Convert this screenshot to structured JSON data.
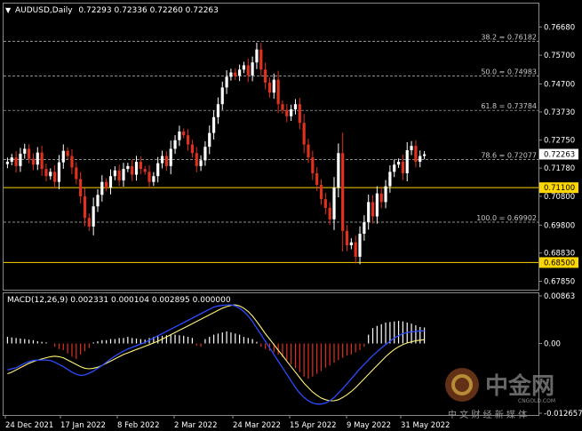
{
  "header": {
    "symbol": "AUDUSD,Daily",
    "ohlc": "0.72293 0.72336 0.72260 0.72263"
  },
  "macd_header": {
    "title": "MACD(12,26,9) 0.002331 0.000104 0.002895 0.000000"
  },
  "watermark": {
    "cn": "中金网",
    "domain": "CNGOLD.COM",
    "tagline": "中 文 财 经 新 媒 体"
  },
  "colors": {
    "bull": "#ffffff",
    "bear": "#e0301e",
    "level_line": "#ffd700",
    "fib_line": "#bbbbbb",
    "signal_line": "#fff27a",
    "macd_line": "#2a4cff",
    "macd_pos": "#ffffff",
    "macd_neg": "#e0301e"
  },
  "chart_data": [
    {
      "type": "candlestick",
      "title": "AUDUSD,Daily",
      "ylim": [
        0.6768,
        0.77
      ],
      "y_ticks": [
        "0.76680",
        "0.75700",
        "0.74700",
        "0.73730",
        "0.72750",
        "0.71780",
        "0.70800",
        "0.69800",
        "0.68830",
        "0.67850"
      ],
      "x_ticks": [
        "24 Dec 2021",
        "17 Jan 2022",
        "8 Feb 2022",
        "2 Mar 2022",
        "24 Mar 2022",
        "15 Apr 2022",
        "9 May 2022",
        "31 May 2022"
      ],
      "current_price": "0.72263",
      "levels": [
        {
          "value": 0.711,
          "label": "0.71100"
        },
        {
          "value": 0.685,
          "label": "0.68500"
        }
      ],
      "fib_levels": [
        {
          "label": "38.2 = 0.76182",
          "value": 0.76182
        },
        {
          "label": "50.0 = 0.74983",
          "value": 0.74983
        },
        {
          "label": "61.8 = 0.73784",
          "value": 0.73784
        },
        {
          "label": "78.6 = 0.72077",
          "value": 0.72077
        },
        {
          "label": "100.0 = 0.69902",
          "value": 0.69902
        }
      ],
      "closes": [
        0.72,
        0.7215,
        0.7185,
        0.7228,
        0.7245,
        0.721,
        0.719,
        0.7232,
        0.7175,
        0.715,
        0.7165,
        0.713,
        0.7198,
        0.7238,
        0.722,
        0.718,
        0.714,
        0.708,
        0.7005,
        0.6975,
        0.7045,
        0.7085,
        0.713,
        0.711,
        0.715,
        0.717,
        0.7135,
        0.7175,
        0.7185,
        0.7155,
        0.72,
        0.7175,
        0.7165,
        0.713,
        0.715,
        0.7195,
        0.722,
        0.7185,
        0.7245,
        0.7275,
        0.7305,
        0.7292,
        0.726,
        0.723,
        0.7185,
        0.7205,
        0.7252,
        0.73,
        0.7355,
        0.74,
        0.7458,
        0.7495,
        0.751,
        0.7498,
        0.752,
        0.7535,
        0.75,
        0.7545,
        0.759,
        0.752,
        0.7475,
        0.744,
        0.7485,
        0.74,
        0.738,
        0.7358,
        0.7382,
        0.74,
        0.7335,
        0.726,
        0.7215,
        0.716,
        0.712,
        0.707,
        0.704,
        0.7,
        0.711,
        0.723,
        0.696,
        0.691,
        0.692,
        0.687,
        0.695,
        0.699,
        0.706,
        0.701,
        0.709,
        0.706,
        0.7115,
        0.7165,
        0.719,
        0.72,
        0.716,
        0.724,
        0.7255,
        0.72,
        0.722,
        0.7226
      ],
      "macd": {
        "ylim": [
          -0.012657,
          0.00863
        ],
        "y_ticks": [
          "0.00863",
          "0.00",
          "-0.012657"
        ],
        "histogram": [
          0.0012,
          0.0011,
          0.001,
          0.0009,
          0.0008,
          0.0007,
          0.0006,
          0.0004,
          0.0003,
          0.0002,
          0.0,
          -0.0006,
          -0.001,
          -0.0012,
          -0.0018,
          -0.0024,
          -0.0028,
          -0.002,
          -0.0014,
          -0.0008,
          0.0002,
          0.0004,
          0.0006,
          0.0006,
          0.0008,
          0.0008,
          0.001,
          0.001,
          0.0012,
          0.001,
          0.0009,
          0.0008,
          0.0007,
          0.001,
          0.0012,
          0.0013,
          0.0014,
          0.0015,
          0.0016,
          0.0016,
          0.0015,
          0.0014,
          0.0012,
          0.001,
          -0.0004,
          -0.0006,
          0.0008,
          0.0012,
          0.0016,
          0.0018,
          0.002,
          0.0022,
          0.002,
          0.0018,
          0.0016,
          0.0012,
          0.001,
          0.0008,
          0.0003,
          -0.0006,
          -0.001,
          -0.0013,
          -0.0016,
          -0.002,
          -0.0025,
          -0.003,
          -0.0038,
          -0.0045,
          -0.0052,
          -0.006,
          -0.0064,
          -0.006,
          -0.0055,
          -0.005,
          -0.0044,
          -0.004,
          -0.0035,
          -0.003,
          -0.0026,
          -0.0022,
          -0.002,
          -0.0016,
          -0.0012,
          -0.0006,
          0.0016,
          0.0028,
          0.0032,
          0.0035,
          0.0038,
          0.0039,
          0.004,
          0.0041,
          0.004,
          0.0038,
          0.0036,
          0.0033,
          0.003,
          0.0029
        ],
        "signal": [
          -0.0055,
          -0.0052,
          -0.0048,
          -0.0044,
          -0.004,
          -0.0036,
          -0.0033,
          -0.003,
          -0.0028,
          -0.0026,
          -0.0024,
          -0.0023,
          -0.0024,
          -0.0026,
          -0.003,
          -0.0034,
          -0.0038,
          -0.0042,
          -0.0045,
          -0.0046,
          -0.0045,
          -0.0043,
          -0.004,
          -0.0036,
          -0.0032,
          -0.0028,
          -0.0024,
          -0.002,
          -0.0017,
          -0.0014,
          -0.0011,
          -0.0008,
          -0.0005,
          -0.0002,
          0.0001,
          0.0004,
          0.0008,
          0.0012,
          0.0016,
          0.002,
          0.0024,
          0.0028,
          0.0032,
          0.0036,
          0.004,
          0.0044,
          0.0048,
          0.0052,
          0.0056,
          0.006,
          0.0064,
          0.0067,
          0.0069,
          0.007,
          0.0068,
          0.0064,
          0.0058,
          0.005,
          0.004,
          0.0029,
          0.0018,
          0.0008,
          -0.0002,
          -0.0012,
          -0.0022,
          -0.0032,
          -0.0042,
          -0.0052,
          -0.0062,
          -0.0072,
          -0.008,
          -0.0088,
          -0.0094,
          -0.0099,
          -0.0102,
          -0.0104,
          -0.0104,
          -0.0102,
          -0.0098,
          -0.0093,
          -0.0087,
          -0.008,
          -0.0072,
          -0.0064,
          -0.0056,
          -0.0048,
          -0.004,
          -0.0032,
          -0.0024,
          -0.0017,
          -0.0011,
          -0.0006,
          -0.0002,
          0.0001,
          0.0003,
          0.0005,
          0.0006,
          0.0007
        ],
        "macd_line": [
          -0.0048,
          -0.0046,
          -0.0044,
          -0.004,
          -0.0036,
          -0.0033,
          -0.0031,
          -0.003,
          -0.003,
          -0.003,
          -0.0031,
          -0.0034,
          -0.0038,
          -0.0042,
          -0.0047,
          -0.0052,
          -0.0056,
          -0.0058,
          -0.0057,
          -0.0054,
          -0.005,
          -0.0045,
          -0.004,
          -0.0034,
          -0.0028,
          -0.0023,
          -0.0018,
          -0.0014,
          -0.001,
          -0.0007,
          -0.0004,
          -0.0001,
          0.0002,
          0.0006,
          0.001,
          0.0014,
          0.0018,
          0.0022,
          0.0026,
          0.003,
          0.0034,
          0.0038,
          0.0042,
          0.0046,
          0.005,
          0.0054,
          0.0058,
          0.0062,
          0.0066,
          0.0068,
          0.0069,
          0.007,
          0.007,
          0.0068,
          0.0064,
          0.0058,
          0.005,
          0.004,
          0.0028,
          0.0016,
          0.0004,
          -0.0008,
          -0.002,
          -0.0032,
          -0.0044,
          -0.0056,
          -0.0068,
          -0.008,
          -0.009,
          -0.0098,
          -0.0104,
          -0.0108,
          -0.011,
          -0.011,
          -0.0108,
          -0.0104,
          -0.0098,
          -0.009,
          -0.0082,
          -0.0073,
          -0.0064,
          -0.0055,
          -0.0046,
          -0.0038,
          -0.003,
          -0.0022,
          -0.0015,
          -0.0008,
          -0.0002,
          0.0004,
          0.001,
          0.0014,
          0.0018,
          0.002,
          0.0021,
          0.0022,
          0.0023,
          0.0023
        ]
      }
    }
  ]
}
